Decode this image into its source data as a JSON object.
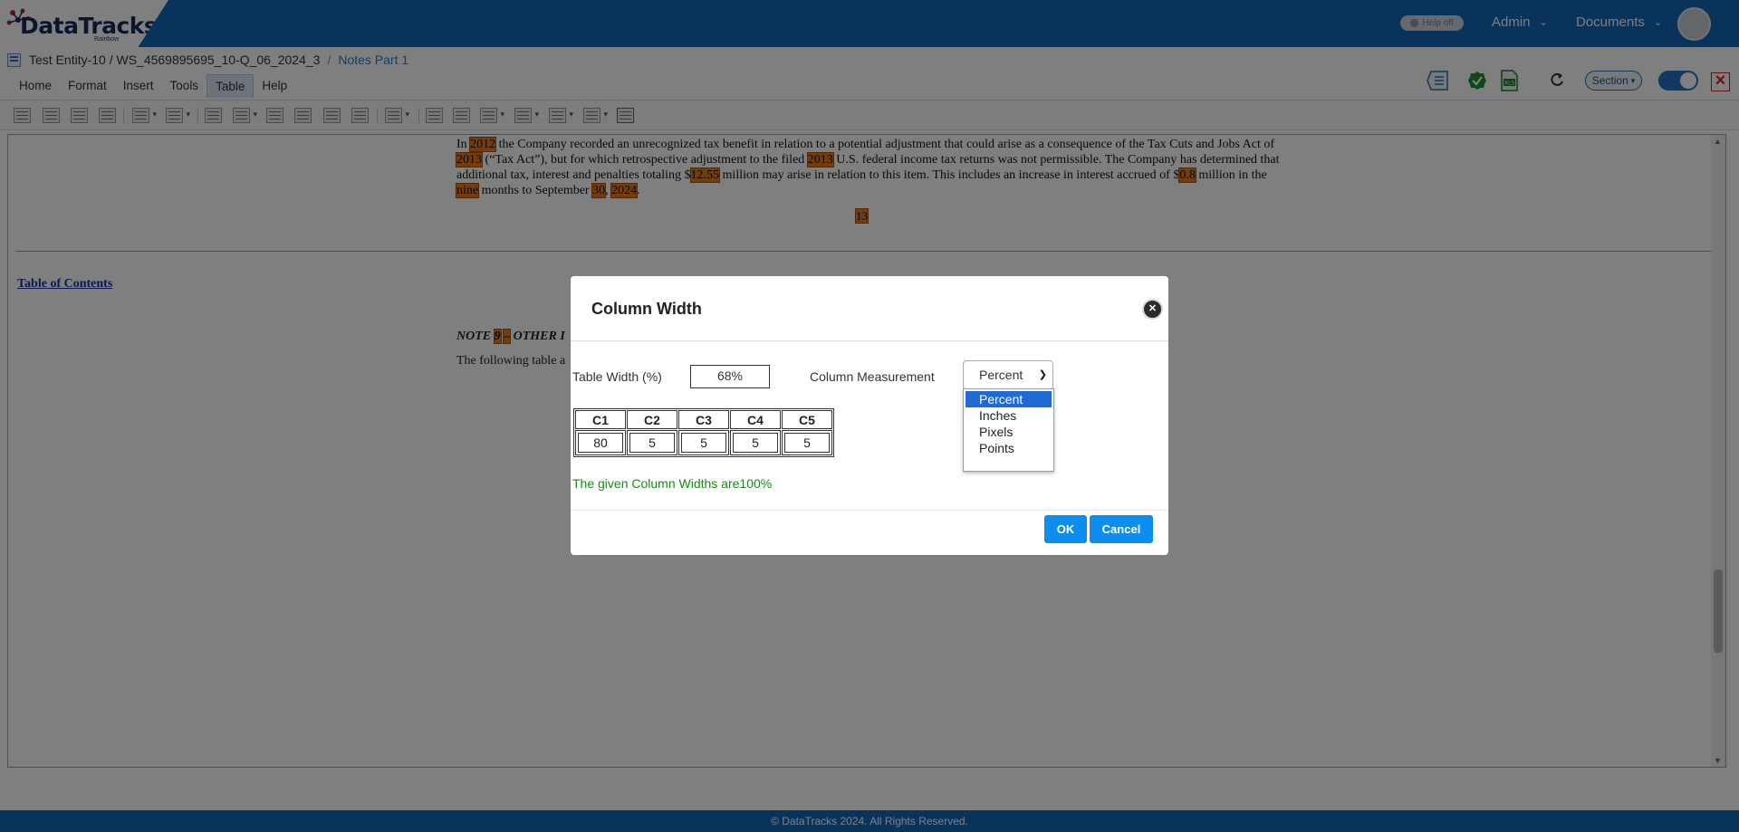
{
  "brand": {
    "name": "DataTracks",
    "tagline": "Rainbow"
  },
  "header": {
    "help_toggle_label": "Help off",
    "admin_label": "Admin",
    "documents_label": "Documents"
  },
  "breadcrumb": {
    "entity": "Test Entity-10 / WS_4569895695_10-Q_06_2024_3",
    "separator": "/",
    "current": "Notes Part 1"
  },
  "menu": {
    "tabs": [
      {
        "label": "Home"
      },
      {
        "label": "Format"
      },
      {
        "label": "Insert"
      },
      {
        "label": "Tools"
      },
      {
        "label": "Table",
        "active": true
      },
      {
        "label": "Help"
      }
    ]
  },
  "right_tools": {
    "section_label": "Section"
  },
  "document": {
    "para": {
      "t1": "In ",
      "h1": "2012",
      "t2": " the Company recorded an unrecognized tax benefit in relation to a potential adjustment that could arise as a consequence of the Tax Cuts and Jobs Act of ",
      "h2": "2013",
      "t3": " (“Tax Act”), but for which retrospective adjustment to the filed ",
      "h3": "2013",
      "t4": " U.S. federal income tax returns was not permissible. The Company has determined that additional tax, interest and penalties totaling $",
      "h4": "12.55",
      "t5": " million may arise in relation to this item. This includes an increase in interest accrued of $",
      "h5": "0.8",
      "t6": " million in the ",
      "h6": "nine",
      "t7": " months to September ",
      "h7": "30",
      "t8": ", ",
      "h8": "2024",
      "t9": "."
    },
    "page_number": "13",
    "toc_link": "Table of Contents",
    "note": {
      "prefix": "NOTE ",
      "num": "9",
      "dash": "–",
      "rest": " OTHER I"
    },
    "note_body": "The following table a"
  },
  "footer": {
    "copyright": "© DataTracks 2024. All Rights Reserved."
  },
  "modal": {
    "title": "Column Width",
    "table_width_label": "Table Width (%)",
    "table_width_value": "68%",
    "column_measurement_label": "Column Measurement",
    "measurement_selected": "Percent",
    "measurement_options": [
      "Percent",
      "Inches",
      "Pixels",
      "Points"
    ],
    "columns": [
      {
        "header": "C1",
        "value": "80"
      },
      {
        "header": "C2",
        "value": "5"
      },
      {
        "header": "C3",
        "value": "5"
      },
      {
        "header": "C4",
        "value": "5"
      },
      {
        "header": "C5",
        "value": "5"
      }
    ],
    "message": "The given Column Widths are100%",
    "ok_label": "OK",
    "cancel_label": "Cancel"
  },
  "colors": {
    "header_blue": "#1467b8",
    "highlight_orange": "#e87a1b",
    "button_blue": "#0b8ef0",
    "success_green": "#168a16",
    "link_blue": "#2d7ac5"
  }
}
